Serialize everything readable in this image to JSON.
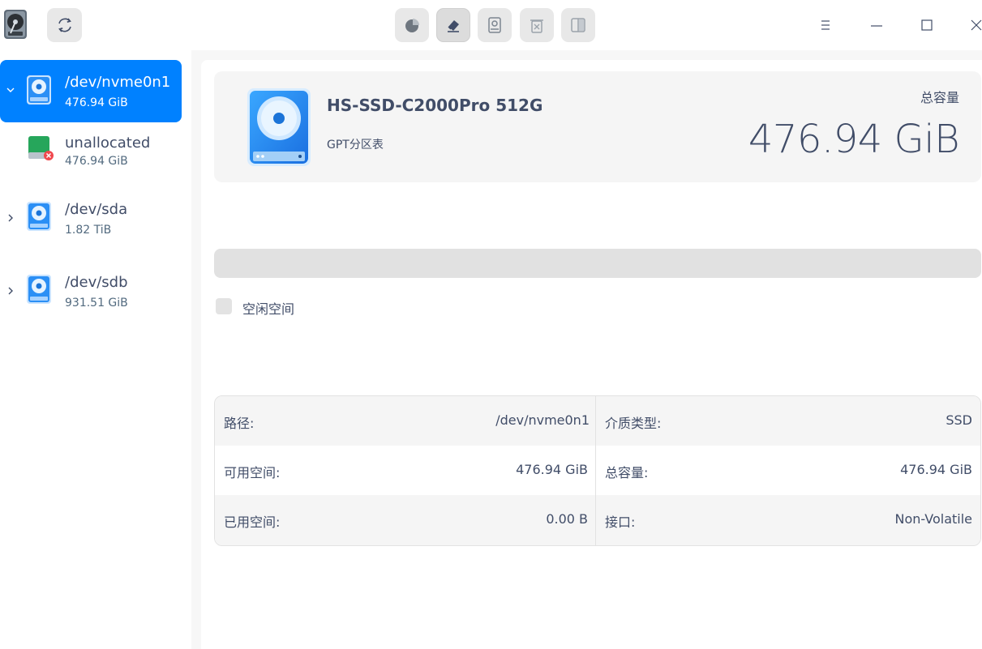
{
  "toolbar": {
    "buttons": [
      {
        "name": "partition-pie-icon"
      },
      {
        "name": "eraser-icon"
      },
      {
        "name": "mount-icon"
      },
      {
        "name": "delete-icon"
      },
      {
        "name": "split-icon"
      }
    ]
  },
  "sidebar": {
    "items": [
      {
        "name": "/dev/nvme0n1",
        "size": "476.94 GiB",
        "selected": true,
        "expanded": true
      },
      {
        "name": "unallocated",
        "size": "476.94 GiB",
        "child": true
      },
      {
        "name": "/dev/sda",
        "size": "1.82 TiB",
        "expanded": false
      },
      {
        "name": "/dev/sdb",
        "size": "931.51 GiB",
        "expanded": false
      }
    ]
  },
  "header": {
    "model": "HS-SSD-C2000Pro 512G",
    "partition_table": "GPT分区表",
    "total_label": "总容量",
    "total_value": "476.94 GiB"
  },
  "usage": {
    "legend_label": "空闲空间",
    "used_fraction": 0.0
  },
  "info": {
    "rows": [
      {
        "k1": "路径:",
        "v1": "/dev/nvme0n1",
        "k2": "介质类型:",
        "v2": "SSD"
      },
      {
        "k1": "可用空间:",
        "v1": "476.94 GiB",
        "k2": "总容量:",
        "v2": "476.94 GiB"
      },
      {
        "k1": "已用空间:",
        "v1": "0.00 B",
        "k2": "接口:",
        "v2": "Non-Volatile"
      }
    ]
  },
  "colors": {
    "accent": "#0081ff",
    "text": "#414d68",
    "disk_blue": "#2b8ff5",
    "unallocated_green": "#26a65b"
  }
}
